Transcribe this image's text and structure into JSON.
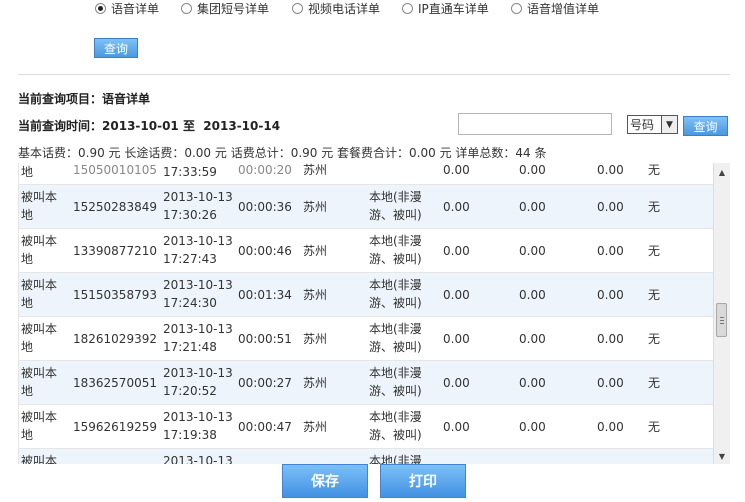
{
  "radio_options": [
    {
      "label": "语音详单",
      "checked": true
    },
    {
      "label": "集团短号详单",
      "checked": false
    },
    {
      "label": "视频电话详单",
      "checked": false
    },
    {
      "label": "IP直通车详单",
      "checked": false
    },
    {
      "label": "语音增值详单",
      "checked": false
    }
  ],
  "query_button_label": "查询",
  "current_item_label": "当前查询项目：",
  "current_item_value": "语音详单",
  "current_time_label": "当前查询时间：",
  "current_time_value": "2013-10-01 至  2013-10-14",
  "search": {
    "value": "",
    "select_value": "号码",
    "button_label": "查询"
  },
  "summary": "基本话费：0.90 元 长途话费：0.00 元 话费总计：0.90 元 套餐费合计：0.00 元 详单总数：44 条",
  "partial_top_row": {
    "type_line2": "地",
    "number": "15050010105",
    "time": "17:33:59",
    "duration": "00:00:20",
    "place": "苏州",
    "fee1": "0.00",
    "fee2": "0.00",
    "fee3": "0.00",
    "plan": "无"
  },
  "rows": [
    {
      "type_line1": "被叫本",
      "type_line2": "地",
      "number": "15250283849",
      "date": "2013-10-13",
      "time": "17:30:26",
      "duration": "00:00:36",
      "place": "苏州",
      "roam_line1": "本地(非漫",
      "roam_line2": "游、被叫)",
      "fee1": "0.00",
      "fee2": "0.00",
      "fee3": "0.00",
      "plan": "无"
    },
    {
      "type_line1": "被叫本",
      "type_line2": "地",
      "number": "13390877210",
      "date": "2013-10-13",
      "time": "17:27:43",
      "duration": "00:00:46",
      "place": "苏州",
      "roam_line1": "本地(非漫",
      "roam_line2": "游、被叫)",
      "fee1": "0.00",
      "fee2": "0.00",
      "fee3": "0.00",
      "plan": "无"
    },
    {
      "type_line1": "被叫本",
      "type_line2": "地",
      "number": "15150358793",
      "date": "2013-10-13",
      "time": "17:24:30",
      "duration": "00:01:34",
      "place": "苏州",
      "roam_line1": "本地(非漫",
      "roam_line2": "游、被叫)",
      "fee1": "0.00",
      "fee2": "0.00",
      "fee3": "0.00",
      "plan": "无"
    },
    {
      "type_line1": "被叫本",
      "type_line2": "地",
      "number": "18261029392",
      "date": "2013-10-13",
      "time": "17:21:48",
      "duration": "00:00:51",
      "place": "苏州",
      "roam_line1": "本地(非漫",
      "roam_line2": "游、被叫)",
      "fee1": "0.00",
      "fee2": "0.00",
      "fee3": "0.00",
      "plan": "无"
    },
    {
      "type_line1": "被叫本",
      "type_line2": "地",
      "number": "18362570051",
      "date": "2013-10-13",
      "time": "17:20:52",
      "duration": "00:00:27",
      "place": "苏州",
      "roam_line1": "本地(非漫",
      "roam_line2": "游、被叫)",
      "fee1": "0.00",
      "fee2": "0.00",
      "fee3": "0.00",
      "plan": "无"
    },
    {
      "type_line1": "被叫本",
      "type_line2": "地",
      "number": "15962619259",
      "date": "2013-10-13",
      "time": "17:19:38",
      "duration": "00:00:47",
      "place": "苏州",
      "roam_line1": "本地(非漫",
      "roam_line2": "游、被叫)",
      "fee1": "0.00",
      "fee2": "0.00",
      "fee3": "0.00",
      "plan": "无"
    }
  ],
  "partial_bottom_row": {
    "type_line1": "被叫本",
    "date": "2013-10-13",
    "roam_line1": "本地(非漫"
  },
  "save_button_label": "保存",
  "print_button_label": "打印",
  "colors": {
    "button_blue": "#4a98df",
    "row_alt_bg": "#eef4fb"
  }
}
